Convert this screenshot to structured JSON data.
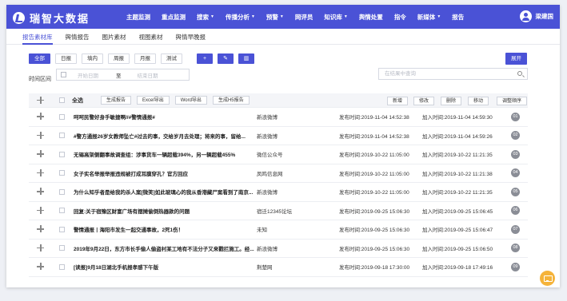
{
  "brand": {
    "name": "瑞智大数据"
  },
  "nav": [
    {
      "label": "主题监测",
      "caret": false
    },
    {
      "label": "重点监测",
      "caret": false
    },
    {
      "label": "搜索",
      "caret": true
    },
    {
      "label": "传播分析",
      "caret": true
    },
    {
      "label": "预警",
      "caret": true
    },
    {
      "label": "网评员",
      "caret": false
    },
    {
      "label": "知识库",
      "caret": true
    },
    {
      "label": "舆情处置",
      "caret": false
    },
    {
      "label": "指令",
      "caret": false
    },
    {
      "label": "新媒体",
      "caret": true
    },
    {
      "label": "报告",
      "caret": false
    }
  ],
  "user": {
    "name": "梁建国"
  },
  "subtabs": [
    "报告素材库",
    "舆情报告",
    "图片素材",
    "视图素材",
    "舆情早晚报"
  ],
  "active_subtab": 0,
  "filters": [
    "全部",
    "日报",
    "填内",
    "周报",
    "月报",
    "测试"
  ],
  "active_filter": 0,
  "icon_buttons": [
    {
      "glyph": "+",
      "icon": "add-icon"
    },
    {
      "glyph": "✎",
      "icon": "edit-icon"
    },
    {
      "glyph": "▥",
      "icon": "delete-icon"
    }
  ],
  "expand_label": "展开",
  "date": {
    "label": "时间区间",
    "start_placeholder": "开始日期",
    "separator": "至",
    "end_placeholder": "结束日期"
  },
  "search": {
    "placeholder": "在结果中查询"
  },
  "toolbar": {
    "select_all": "全选",
    "left_buttons": [
      "生成报告",
      "Excel导出",
      "Word导出",
      "生成H5报告"
    ],
    "right_buttons": [
      "新增",
      "修改",
      "删除",
      "移动",
      "调整顺序"
    ]
  },
  "rows": [
    {
      "title": "呵呵民警好身手敏捷啊//#警情通报#",
      "source": "新浪微博",
      "published": "发布时间:2019-11-04 14:52:38",
      "added": "加入时间:2019-11-04 14:59:30",
      "num": "01"
    },
    {
      "title": "#警方通报26岁女教师坠亡#过去的事，交给岁月去处理；将来的事，留给...",
      "source": "新浪微博",
      "published": "发布时间:2019-11-04 14:52:38",
      "added": "加入时间:2019-11-04 14:59:26",
      "num": "02"
    },
    {
      "title": "无锡高架侧翻事故调查组：涉事货车一辆超载394%，另一辆超载455%",
      "source": "微信公众号",
      "published": "发布时间:2019-10-22 11:05:00",
      "added": "加入时间:2019-10-22 11:21:35",
      "num": "03"
    },
    {
      "title": "女子实名举报举报违规被打成耳膜穿孔？官方回应",
      "source": "凤鸣信息网",
      "published": "发布时间:2019-10-22 11:05:00",
      "added": "加入时间:2019-10-22 11:21:38",
      "num": "04"
    },
    {
      "title": "为什么知乎者是给我的杀人案[微笑]如此玻璃心的我从香港藏尸案看到了南京...",
      "source": "新浪微博",
      "published": "发布时间:2019-10-22 11:05:00",
      "added": "加入时间:2019-10-22 11:21:35",
      "num": "05"
    },
    {
      "title": "回复:关于宿豫区财富广场有摆摊偷倒热器款的问题",
      "source": "宿迁12345论坛",
      "published": "发布时间:2019-09-25 15:06:30",
      "added": "加入时间:2019-09-25 15:06:45",
      "num": "06"
    },
    {
      "title": "警情通报丨海阳市发生一起交通事故，2死1伤！",
      "source": "未知",
      "published": "发布时间:2019-09-25 15:06:30",
      "added": "加入时间:2019-09-25 15:06:47",
      "num": "07"
    },
    {
      "title": "2019年9月22日，东方市长手偷人偷盗村某工地有不法分子又来戳拦施工。经...",
      "source": "新浪微博",
      "published": "发布时间:2019-09-25 15:06:30",
      "added": "加入时间:2019-09-25 15:06:50",
      "num": "08"
    },
    {
      "title": "[读报]9月18日湖北手机报孝感下午版",
      "source": "荆楚网",
      "published": "发布时间:2019-09-18 17:30:00",
      "added": "加入时间:2019-09-18 17:49:16",
      "num": "09"
    }
  ],
  "colors": {
    "primary": "#4a52d6",
    "fab": "#f5b33a",
    "badge": "#8a8d96"
  }
}
